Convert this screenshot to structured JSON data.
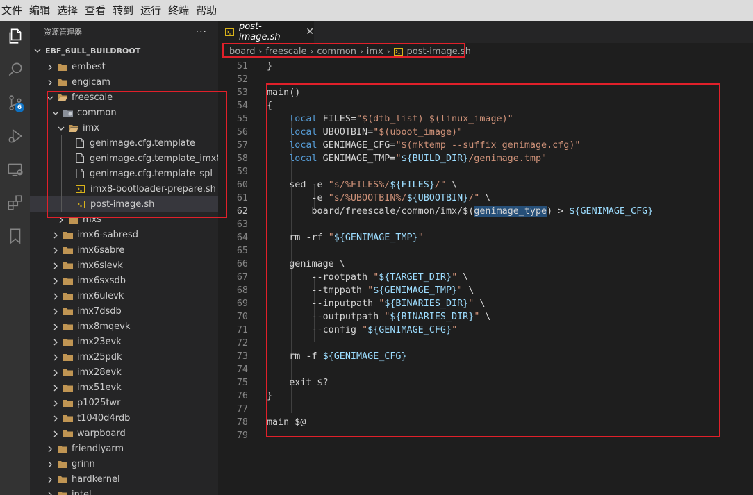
{
  "menu": [
    "文件",
    "编辑",
    "选择",
    "查看",
    "转到",
    "运行",
    "终端",
    "帮助"
  ],
  "activity": {
    "scm_badge": "6",
    "icons": [
      "explorer-icon",
      "search-icon",
      "source-control-icon",
      "run-debug-icon",
      "remote-explorer-icon",
      "extensions-icon",
      "bookmarks-icon"
    ]
  },
  "sidebar": {
    "title": "资源管理器",
    "more": "···",
    "root": "EBF_6ULL_BUILDROOT",
    "tree": [
      {
        "label": "embest",
        "type": "folder",
        "depth": 0,
        "expanded": false
      },
      {
        "label": "engicam",
        "type": "folder",
        "depth": 0,
        "expanded": false
      },
      {
        "label": "freescale",
        "type": "folder",
        "depth": 0,
        "expanded": true
      },
      {
        "label": "common",
        "type": "folder-special",
        "depth": 1,
        "expanded": true
      },
      {
        "label": "imx",
        "type": "folder",
        "depth": 2,
        "expanded": true
      },
      {
        "label": "genimage.cfg.template",
        "type": "file",
        "depth": 3
      },
      {
        "label": "genimage.cfg.template_imx8",
        "type": "file",
        "depth": 3
      },
      {
        "label": "genimage.cfg.template_spl",
        "type": "file",
        "depth": 3
      },
      {
        "label": "imx8-bootloader-prepare.sh",
        "type": "shell",
        "depth": 3
      },
      {
        "label": "post-image.sh",
        "type": "shell",
        "depth": 3,
        "selected": true
      },
      {
        "label": "mxs",
        "type": "folder",
        "depth": 2,
        "expanded": false
      },
      {
        "label": "imx6-sabresd",
        "type": "folder",
        "depth": 1,
        "expanded": false
      },
      {
        "label": "imx6sabre",
        "type": "folder",
        "depth": 1,
        "expanded": false
      },
      {
        "label": "imx6slevk",
        "type": "folder",
        "depth": 1,
        "expanded": false
      },
      {
        "label": "imx6sxsdb",
        "type": "folder",
        "depth": 1,
        "expanded": false
      },
      {
        "label": "imx6ulevk",
        "type": "folder",
        "depth": 1,
        "expanded": false
      },
      {
        "label": "imx7dsdb",
        "type": "folder",
        "depth": 1,
        "expanded": false
      },
      {
        "label": "imx8mqevk",
        "type": "folder",
        "depth": 1,
        "expanded": false
      },
      {
        "label": "imx23evk",
        "type": "folder",
        "depth": 1,
        "expanded": false
      },
      {
        "label": "imx25pdk",
        "type": "folder",
        "depth": 1,
        "expanded": false
      },
      {
        "label": "imx28evk",
        "type": "folder",
        "depth": 1,
        "expanded": false
      },
      {
        "label": "imx51evk",
        "type": "folder",
        "depth": 1,
        "expanded": false
      },
      {
        "label": "p1025twr",
        "type": "folder",
        "depth": 1,
        "expanded": false
      },
      {
        "label": "t1040d4rdb",
        "type": "folder",
        "depth": 1,
        "expanded": false
      },
      {
        "label": "warpboard",
        "type": "folder",
        "depth": 1,
        "expanded": false
      },
      {
        "label": "friendlyarm",
        "type": "folder",
        "depth": 0,
        "expanded": false
      },
      {
        "label": "grinn",
        "type": "folder",
        "depth": 0,
        "expanded": false
      },
      {
        "label": "hardkernel",
        "type": "folder",
        "depth": 0,
        "expanded": false
      },
      {
        "label": "intel",
        "type": "folder",
        "depth": 0,
        "expanded": false
      }
    ]
  },
  "tab": {
    "label": "post-image.sh",
    "close": "✕"
  },
  "breadcrumb": [
    "board",
    "freescale",
    "common",
    "imx",
    "post-image.sh"
  ],
  "colors": {
    "keyword": "#569cd6",
    "string": "#ce9178",
    "variable": "#9cdcfe",
    "text": "#d4d4d4",
    "highlight_box": "#e0202a"
  },
  "code": {
    "active_line": 62,
    "lines": [
      {
        "n": "51",
        "tokens": [
          [
            "t",
            "}"
          ]
        ]
      },
      {
        "n": "52",
        "tokens": []
      },
      {
        "n": "53",
        "tokens": [
          [
            "t",
            "main()"
          ]
        ]
      },
      {
        "n": "54",
        "tokens": [
          [
            "t",
            "{"
          ]
        ]
      },
      {
        "n": "55",
        "tokens": [
          [
            "t",
            "    "
          ],
          [
            "kw",
            "local"
          ],
          [
            "t",
            " FILES="
          ],
          [
            "str",
            "\"$(dtb_list) $(linux_image)\""
          ]
        ]
      },
      {
        "n": "56",
        "tokens": [
          [
            "t",
            "    "
          ],
          [
            "kw",
            "local"
          ],
          [
            "t",
            " UBOOTBIN="
          ],
          [
            "str",
            "\"$(uboot_image)\""
          ]
        ]
      },
      {
        "n": "57",
        "tokens": [
          [
            "t",
            "    "
          ],
          [
            "kw",
            "local"
          ],
          [
            "t",
            " GENIMAGE_CFG="
          ],
          [
            "str",
            "\"$(mktemp --suffix genimage.cfg)\""
          ]
        ]
      },
      {
        "n": "58",
        "tokens": [
          [
            "t",
            "    "
          ],
          [
            "kw",
            "local"
          ],
          [
            "t",
            " GENIMAGE_TMP="
          ],
          [
            "str",
            "\""
          ],
          [
            "var",
            "${BUILD_DIR}"
          ],
          [
            "str",
            "/genimage.tmp\""
          ]
        ]
      },
      {
        "n": "59",
        "tokens": []
      },
      {
        "n": "60",
        "tokens": [
          [
            "t",
            "    sed -e "
          ],
          [
            "str",
            "\"s/%FILES%/"
          ],
          [
            "var",
            "${FILES}"
          ],
          [
            "str",
            "/\""
          ],
          [
            "t",
            " \\"
          ]
        ]
      },
      {
        "n": "61",
        "tokens": [
          [
            "t",
            "        -e "
          ],
          [
            "str",
            "\"s/%UBOOTBIN%/"
          ],
          [
            "var",
            "${UBOOTBIN}"
          ],
          [
            "str",
            "/\""
          ],
          [
            "t",
            " \\"
          ]
        ]
      },
      {
        "n": "62",
        "tokens": [
          [
            "t",
            "        board/freescale/common/imx/$("
          ],
          [
            "hl",
            "genimage_type"
          ],
          [
            "t",
            ") > "
          ],
          [
            "var",
            "${GENIMAGE_CFG}"
          ]
        ]
      },
      {
        "n": "63",
        "tokens": []
      },
      {
        "n": "64",
        "tokens": [
          [
            "t",
            "    rm -rf "
          ],
          [
            "str",
            "\""
          ],
          [
            "var",
            "${GENIMAGE_TMP}"
          ],
          [
            "str",
            "\""
          ]
        ]
      },
      {
        "n": "65",
        "tokens": []
      },
      {
        "n": "66",
        "tokens": [
          [
            "t",
            "    genimage \\"
          ]
        ]
      },
      {
        "n": "67",
        "tokens": [
          [
            "t",
            "        --rootpath "
          ],
          [
            "str",
            "\""
          ],
          [
            "var",
            "${TARGET_DIR}"
          ],
          [
            "str",
            "\""
          ],
          [
            "t",
            " \\"
          ]
        ]
      },
      {
        "n": "68",
        "tokens": [
          [
            "t",
            "        --tmppath "
          ],
          [
            "str",
            "\""
          ],
          [
            "var",
            "${GENIMAGE_TMP}"
          ],
          [
            "str",
            "\""
          ],
          [
            "t",
            " \\"
          ]
        ]
      },
      {
        "n": "69",
        "tokens": [
          [
            "t",
            "        --inputpath "
          ],
          [
            "str",
            "\""
          ],
          [
            "var",
            "${BINARIES_DIR}"
          ],
          [
            "str",
            "\""
          ],
          [
            "t",
            " \\"
          ]
        ]
      },
      {
        "n": "70",
        "tokens": [
          [
            "t",
            "        --outputpath "
          ],
          [
            "str",
            "\""
          ],
          [
            "var",
            "${BINARIES_DIR}"
          ],
          [
            "str",
            "\""
          ],
          [
            "t",
            " \\"
          ]
        ]
      },
      {
        "n": "71",
        "tokens": [
          [
            "t",
            "        --config "
          ],
          [
            "str",
            "\""
          ],
          [
            "var",
            "${GENIMAGE_CFG}"
          ],
          [
            "str",
            "\""
          ]
        ]
      },
      {
        "n": "72",
        "tokens": []
      },
      {
        "n": "73",
        "tokens": [
          [
            "t",
            "    rm -f "
          ],
          [
            "var",
            "${GENIMAGE_CFG}"
          ]
        ]
      },
      {
        "n": "74",
        "tokens": []
      },
      {
        "n": "75",
        "tokens": [
          [
            "t",
            "    exit $?"
          ]
        ]
      },
      {
        "n": "76",
        "tokens": [
          [
            "t",
            "}"
          ]
        ]
      },
      {
        "n": "77",
        "tokens": []
      },
      {
        "n": "78",
        "tokens": [
          [
            "t",
            "main $@"
          ]
        ]
      },
      {
        "n": "79",
        "tokens": []
      }
    ]
  }
}
